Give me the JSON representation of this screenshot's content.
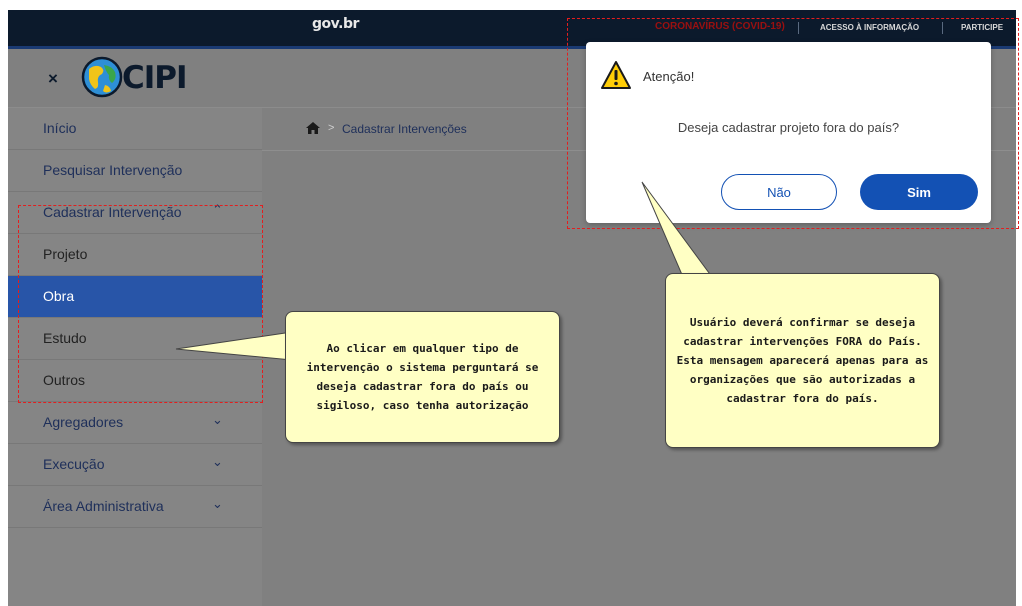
{
  "topbar": {
    "brand": "gov.br",
    "links": [
      "CORONAVÍRUS (COVID-19)",
      "ACESSO À INFORMAÇÃO",
      "PARTICIPE"
    ]
  },
  "header": {
    "close_glyph": "×",
    "logo_text": "CIPI",
    "logo_icon": "globe-logo-icon"
  },
  "sidebar": {
    "items": [
      {
        "label": "Início"
      },
      {
        "label": "Pesquisar Intervenção"
      },
      {
        "label": "Cadastrar Intervenção",
        "chevron": "up"
      },
      {
        "label": "Projeto"
      },
      {
        "label": "Obra",
        "active": true
      },
      {
        "label": "Estudo"
      },
      {
        "label": "Outros"
      },
      {
        "label": "Agregadores",
        "chevron": "down"
      },
      {
        "label": "Execução",
        "chevron": "down"
      },
      {
        "label": "Área Administrativa",
        "chevron": "down"
      }
    ]
  },
  "breadcrumb": {
    "home_icon": "home-icon",
    "separator": ">",
    "current": "Cadastrar Intervenções"
  },
  "dialog": {
    "icon": "warning-icon",
    "title": "Atenção!",
    "message": "Deseja cadastrar projeto fora do país?",
    "cancel_label": "Não",
    "confirm_label": "Sim"
  },
  "annotations": {
    "left_note": "Ao clicar em qualquer tipo de intervenção o sistema perguntará se deseja cadastrar fora do país ou sigiloso, caso tenha autorização",
    "right_note": "Usuário deverá confirmar se deseja cadastrar intervenções FORA do País. Esta mensagem aparecerá apenas para as organizações que são autorizadas a cadastrar fora do país."
  },
  "colors": {
    "topbar_bg": "#0c1a2c",
    "overlay_gray": "#808080",
    "active_item": "#2855a8",
    "primary_button": "#1351b4",
    "callout_bg": "#ffffc4",
    "annotation_red": "#e31e1e",
    "warning_yellow": "#ffcd07"
  }
}
